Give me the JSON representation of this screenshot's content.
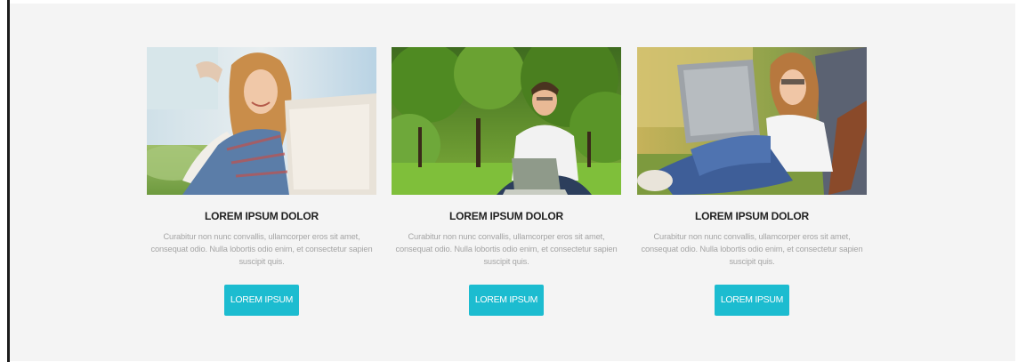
{
  "cards": [
    {
      "title": "LOREM IPSUM DOLOR",
      "text": "Curabitur non nunc convallis, ullamcorper eros sit amet, consequat odio. Nulla lobortis odio enim, et consectetur sapien suscipit quis.",
      "button_label": "LOREM IPSUM",
      "image": "woman-with-laptop-lying-on-grass"
    },
    {
      "title": "LOREM IPSUM DOLOR",
      "text": "Curabitur non nunc convallis, ullamcorper eros sit amet, consequat odio. Nulla lobortis odio enim, et consectetur sapien suscipit quis.",
      "button_label": "LOREM IPSUM",
      "image": "man-with-laptop-sitting-in-park"
    },
    {
      "title": "LOREM IPSUM DOLOR",
      "text": "Curabitur non nunc convallis, ullamcorper eros sit amet, consequat odio. Nulla lobortis odio enim, et consectetur sapien suscipit quis.",
      "button_label": "LOREM IPSUM",
      "image": "woman-with-laptop-in-lounge-chair"
    }
  ],
  "colors": {
    "accent": "#1cbcd0",
    "background": "#f4f4f4",
    "title": "#222222",
    "body_text": "#a5a5a5"
  }
}
